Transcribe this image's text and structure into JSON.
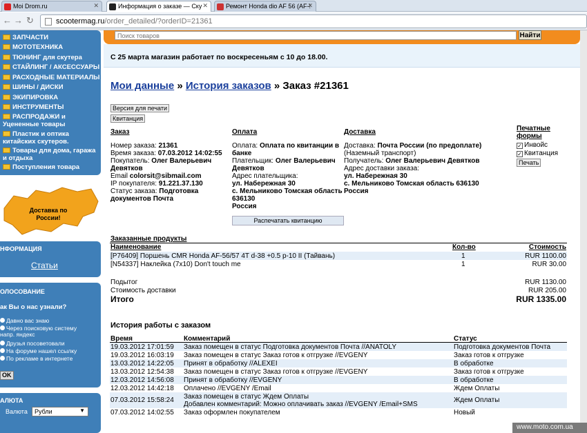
{
  "browser": {
    "tabs": [
      {
        "label": "Moi Drom.ru",
        "active": false
      },
      {
        "label": "Информация о заказе — Ску",
        "active": true
      },
      {
        "label": "Ремонт Honda dio AF 56 (AF-!",
        "active": false
      }
    ],
    "url_host": "scootermag.ru",
    "url_path": "/order_detailed/?orderID=21361"
  },
  "sidebar": {
    "menu": [
      "ЗАПЧАСТИ",
      "МОТОТЕХНИКА",
      "ТЮНИНГ для скутера",
      "СТАЙЛИНГ / АКСЕССУАРЫ",
      "РАСХОДНЫЕ МАТЕРИАЛЫ",
      "ШИНЫ / ДИСКИ",
      "ЭКИПИРОВКА",
      "ИНСТРУМЕНТЫ",
      "РАСПРОДАЖИ и Уцененные товары",
      "Пластик и оптика китайских скутеров.",
      "Товары для дома, гаража и отдыха",
      "Поступления товара"
    ],
    "promo": "Доставка по России!",
    "info_title": "НФОРМАЦИЯ",
    "info_link": "Статьи",
    "poll_title": "ОЛОСОВАНИЕ",
    "poll_question": "ак Вы о нас узнали?",
    "poll_options": [
      "Давно вас знаю",
      "Через поисковую систему напр. яндекс",
      "Друзья посоветовали",
      "На форуме нашел ссылку",
      "По рекламе в интернете"
    ],
    "poll_ok": "OK",
    "currency_title": "АЛЮТА",
    "currency_label": "Валюта",
    "currency_value": "Рубли"
  },
  "search": {
    "placeholder": "Поиск товаров",
    "button": "Найти"
  },
  "announcement": "С 25 марта магазин работает по воскресеньям с 10 до 18.00.",
  "breadcrumb": {
    "my_data": "Мои данные",
    "sep": "»",
    "history": "История заказов",
    "current": "» Заказ #21361"
  },
  "buttons": {
    "print_version": "Версия для печати",
    "receipt": "Квитанция",
    "print_receipt": "Распечатать квитанцию",
    "print": "Печать"
  },
  "order": {
    "head": "Заказ",
    "number_label": "Номер заказа:",
    "number": "21361",
    "time_label": "Время заказа:",
    "time": "07.03.2012 14:02:55",
    "buyer_label": "Покупатель:",
    "buyer": "Олег Валерьевич Девятков",
    "email_label": "Email",
    "email": "colorsit@sibmail.com",
    "ip_label": "IP покупателя:",
    "ip": "91.221.37.130",
    "status_label": "Статус заказа:",
    "status": "Подготовка документов Почта"
  },
  "payment": {
    "head": "Оплата",
    "method_label": "Оплата:",
    "method": "Оплата по квитанции в банке",
    "payer_label": "Плательщик:",
    "payer": "Олег Валерьевич Девятков",
    "addr_label": "Адрес плательщика:",
    "addr1": "ул. Набережная 30",
    "addr2": "с. Мельниково Томская область 636130",
    "country": "Россия"
  },
  "delivery": {
    "head": "Доставка",
    "method_label": "Доставка:",
    "method": "Почта России (по предоплате)",
    "method_note": "(Наземный транспорт)",
    "receiver_label": "Получатель:",
    "receiver": "Олег Валерьевич Девятков",
    "addr_label": "Адрес доставки заказа:",
    "addr1": "ул. Набережная 30",
    "addr2": "с. Мельниково Томская область 636130",
    "country": "Россия"
  },
  "print_forms": {
    "head": "Печатные формы",
    "invoice": "Инвойс",
    "receipt": "Квитанция"
  },
  "products": {
    "title": "Заказанные продукты",
    "cols": {
      "name": "Наименование",
      "qty": "Кол-во",
      "cost": "Стоимость"
    },
    "rows": [
      {
        "name": "[P76409] Поршень CMR Honda AF-56/57 4T d-38 +0.5 p-10 II (Тайвань)",
        "qty": "1",
        "cost": "RUR 1100.00"
      },
      {
        "name": "[N54337] Наклейка (7x10) Don't touch me",
        "qty": "1",
        "cost": "RUR 30.00"
      }
    ],
    "subtotal_label": "Подытог",
    "subtotal": "RUR 1130.00",
    "shipping_label": "Стоимость доставки",
    "shipping": "RUR 205.00",
    "total_label": "Итого",
    "total": "RUR 1335.00"
  },
  "history": {
    "title": "История работы с заказом",
    "cols": {
      "time": "Время",
      "comment": "Комментарий",
      "status": "Статус"
    },
    "rows": [
      {
        "time": "19.03.2012 17:01:59",
        "comment": "Заказ помещен в статус Подготовка документов Почта //ANATOLY",
        "comment2": "",
        "status": "Подготовка документов Почта"
      },
      {
        "time": "19.03.2012 16:03:19",
        "comment": "Заказ помещен в статус Заказ готов к отгрузке //EVGENY",
        "comment2": "",
        "status": "Заказ готов к отгрузке"
      },
      {
        "time": "13.03.2012 14:22:05",
        "comment": "Принят в обработку //ALEXEI",
        "comment2": "",
        "status": "В обработке"
      },
      {
        "time": "13.03.2012 12:54:38",
        "comment": "Заказ помещен в статус Заказ готов к отгрузке //EVGENY",
        "comment2": "",
        "status": "Заказ готов к отгрузке"
      },
      {
        "time": "12.03.2012 14:56:08",
        "comment": "Принят в обработку //EVGENY",
        "comment2": "",
        "status": "В обработке"
      },
      {
        "time": "12.03.2012 14:42:18",
        "comment": "Оплачено //EVGENY /Email",
        "comment2": "",
        "status": "Ждем Оплаты"
      },
      {
        "time": "07.03.2012 15:58:24",
        "comment": "Заказ помещен в статус Ждем Оплаты",
        "comment2": "Добавлен комментарий: Можно оплачивать заказ //EVGENY /Email+SMS",
        "status": "Ждем Оплаты"
      },
      {
        "time": "07.03.2012 14:02:55",
        "comment": "Заказ оформлен покупателем",
        "comment2": "",
        "status": "Новый"
      }
    ]
  },
  "watermark": "www.moto.com.ua",
  "colors": {
    "sidebar": "#3f7fb8",
    "header_orange": "#f28c1e",
    "link": "#1a3f9c",
    "row_alt": "#e4eef8"
  }
}
